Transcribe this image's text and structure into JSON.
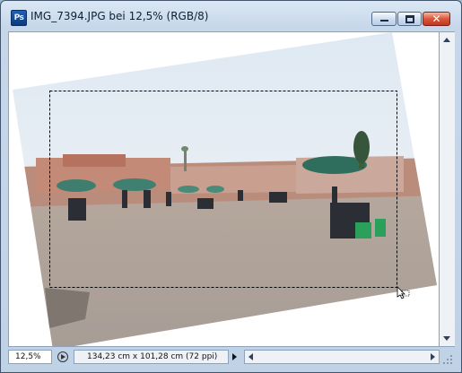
{
  "window": {
    "app_icon_text": "Ps",
    "title": "IMG_7394.JPG bei 12,5% (RGB/8)",
    "close_symbol": "✕"
  },
  "image": {
    "description_icon": "photo-rotated-crop",
    "sky_color": "#e9eef3",
    "ground_color": "#b9aca0"
  },
  "status": {
    "zoom": "12,5%",
    "doc_info": "134,23 cm x 101,28 cm (72 ppi)"
  },
  "colors": {
    "accent": "#1f5fb5",
    "close": "#c2381d"
  }
}
